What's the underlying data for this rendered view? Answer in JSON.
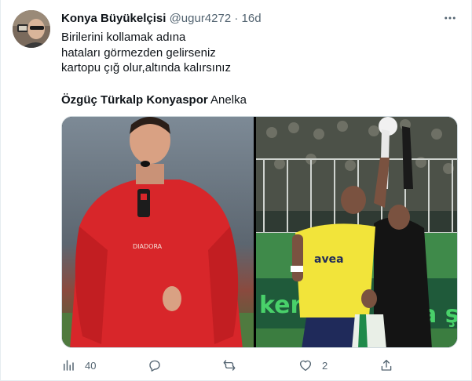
{
  "tweet": {
    "author_name": "Konya Büyükelçisi",
    "handle": "@ugur4272",
    "separator": "·",
    "time": "16d",
    "lines": [
      "Birilerini kollamak adına",
      "hataları görmezden gelirseniz",
      "kartopu çığ olur,altında kalırsınız"
    ],
    "mention_bold": "Özgüç Türkalp Konyaspor",
    "mention_plain": "Anelka",
    "media": [
      {
        "icon": "referee-photo"
      },
      {
        "icon": "football-match-photo"
      }
    ]
  },
  "actions": {
    "views_count": "40",
    "reply_count": "",
    "retweet_count": "",
    "like_count": "2"
  },
  "colors": {
    "text": "#0f1419",
    "secondary": "#536471",
    "border": "#cfd9de"
  }
}
